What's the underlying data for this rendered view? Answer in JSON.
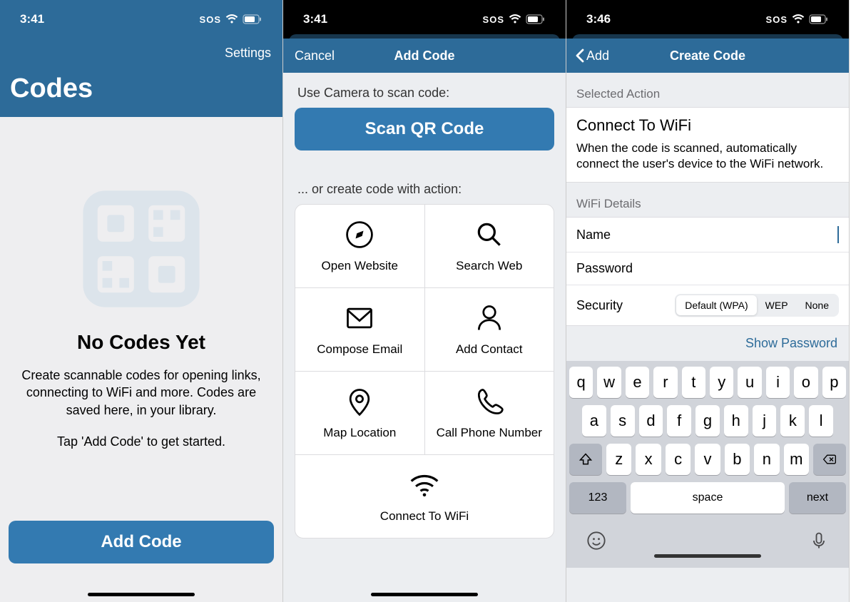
{
  "screen1": {
    "status_time": "3:41",
    "settings": "Settings",
    "title": "Codes",
    "empty_heading": "No Codes Yet",
    "empty_p1": "Create scannable codes for opening links, connecting to WiFi and more. Codes are saved here, in your library.",
    "empty_p2": "Tap 'Add Code' to get started.",
    "add_button": "Add Code"
  },
  "screen2": {
    "status_time": "3:41",
    "cancel": "Cancel",
    "title": "Add Code",
    "scan_label": "Use Camera to scan code:",
    "scan_button": "Scan QR Code",
    "or_label": "... or create code with action:",
    "actions": {
      "open_website": "Open Website",
      "search_web": "Search Web",
      "compose_email": "Compose Email",
      "add_contact": "Add Contact",
      "map_location": "Map Location",
      "call_phone": "Call Phone Number",
      "connect_wifi": "Connect To WiFi"
    }
  },
  "screen3": {
    "status_time": "3:46",
    "back": "Add",
    "title": "Create Code",
    "selected_header": "Selected Action",
    "selected_title": "Connect To WiFi",
    "selected_desc": "When the code is scanned, automatically connect the user's device to the WiFi network.",
    "details_header": "WiFi Details",
    "name_label": "Name",
    "password_label": "Password",
    "security_label": "Security",
    "security_options": {
      "default": "Default (WPA)",
      "wep": "WEP",
      "none": "None"
    },
    "show_password": "Show Password",
    "keyboard": {
      "row1": [
        "q",
        "w",
        "e",
        "r",
        "t",
        "y",
        "u",
        "i",
        "o",
        "p"
      ],
      "row2": [
        "a",
        "s",
        "d",
        "f",
        "g",
        "h",
        "j",
        "k",
        "l"
      ],
      "row3": [
        "z",
        "x",
        "c",
        "v",
        "b",
        "n",
        "m"
      ],
      "numkey": "123",
      "space": "space",
      "next": "next"
    }
  },
  "status": {
    "sos": "SOS"
  }
}
